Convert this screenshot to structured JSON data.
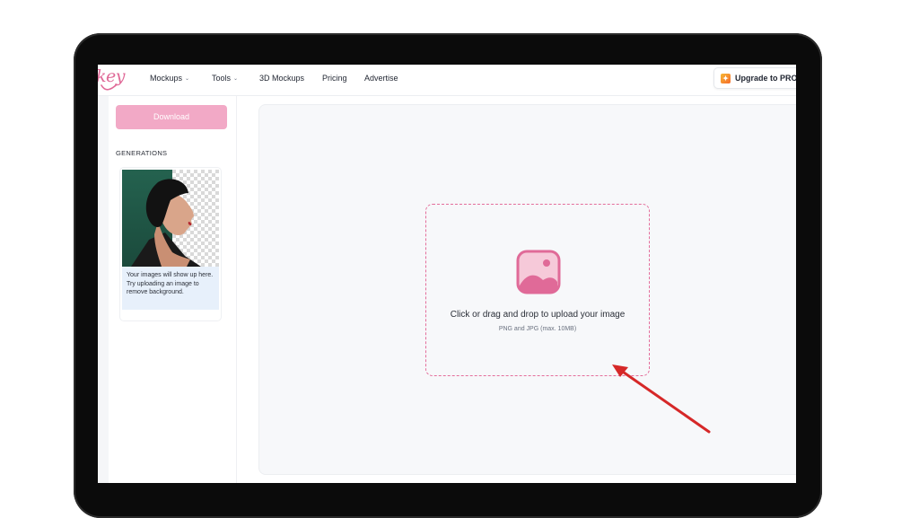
{
  "nav": {
    "logo": "key",
    "items": [
      {
        "label": "Mockups",
        "has_dropdown": true
      },
      {
        "label": "Tools",
        "has_dropdown": true
      },
      {
        "label": "3D Mockups",
        "has_dropdown": false
      },
      {
        "label": "Pricing",
        "has_dropdown": false
      },
      {
        "label": "Advertise",
        "has_dropdown": false
      }
    ],
    "upgrade_label": "Upgrade to PRO",
    "upgrade_icon": "sparkle-icon"
  },
  "sidebar": {
    "download_label": "Download",
    "generations_heading": "GENERATIONS",
    "card_caption": "Your images will show up here. Try uploading an image to remove background."
  },
  "upload": {
    "title": "Click or drag and drop to upload your image",
    "subtitle": "PNG and JPG (max. 10MB)",
    "icon": "image-upload-icon"
  },
  "colors": {
    "accent": "#e06a98",
    "download_button": "#f2a9c6",
    "annotation_arrow": "#d62828",
    "panel_bg": "#f7f8fa"
  }
}
